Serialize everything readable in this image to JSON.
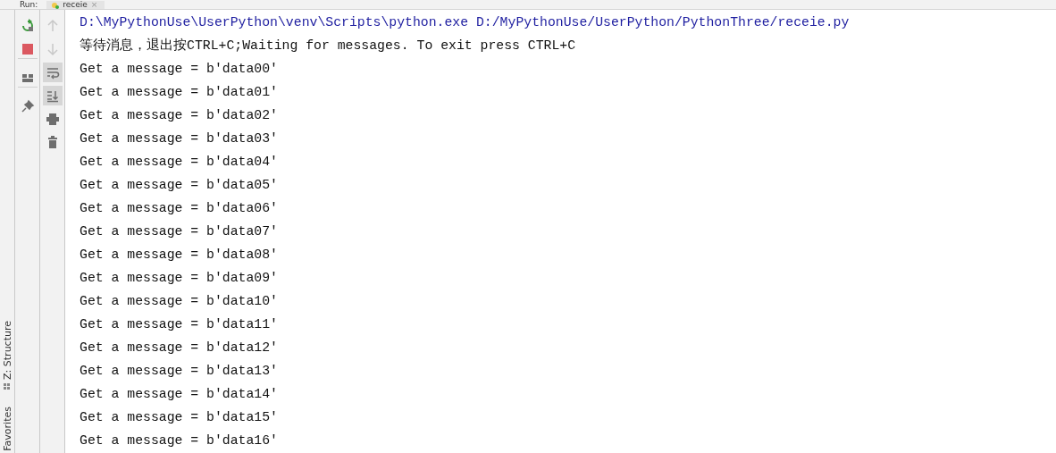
{
  "run_tabs": {
    "label": "Run:",
    "tabs": [
      {
        "label": "receie",
        "selected": true,
        "close": "×"
      }
    ]
  },
  "side_tabs": [
    {
      "label": "Z: Structure",
      "kind": "structure"
    },
    {
      "label": "Favorites",
      "kind": "plain"
    }
  ],
  "toolbar_primary": [
    {
      "kind": "rerun"
    },
    {
      "kind": "stop"
    },
    {
      "kind": "layout"
    },
    {
      "kind": "pin"
    }
  ],
  "toolbar_secondary": [
    {
      "kind": "up",
      "selected": false,
      "disabled": true
    },
    {
      "kind": "down",
      "selected": false,
      "disabled": true
    },
    {
      "kind": "wrap",
      "selected": true,
      "disabled": false
    },
    {
      "kind": "scroll-end",
      "selected": true,
      "disabled": false
    },
    {
      "kind": "print",
      "selected": false,
      "disabled": false
    },
    {
      "kind": "trash",
      "selected": false,
      "disabled": false
    }
  ],
  "console_lines": [
    {
      "kind": "command",
      "text": "D:\\MyPythonUse\\UserPython\\venv\\Scripts\\python.exe D:/MyPythonUse/UserPython/PythonThree/receie.py"
    },
    {
      "kind": "output",
      "text": "等待消息，退出按CTRL+C;Waiting for messages. To exit press CTRL+C"
    },
    {
      "kind": "output",
      "text": "Get a message = b'data00'"
    },
    {
      "kind": "output",
      "text": "Get a message = b'data01'"
    },
    {
      "kind": "output",
      "text": "Get a message = b'data02'"
    },
    {
      "kind": "output",
      "text": "Get a message = b'data03'"
    },
    {
      "kind": "output",
      "text": "Get a message = b'data04'"
    },
    {
      "kind": "output",
      "text": "Get a message = b'data05'"
    },
    {
      "kind": "output",
      "text": "Get a message = b'data06'"
    },
    {
      "kind": "output",
      "text": "Get a message = b'data07'"
    },
    {
      "kind": "output",
      "text": "Get a message = b'data08'"
    },
    {
      "kind": "output",
      "text": "Get a message = b'data09'"
    },
    {
      "kind": "output",
      "text": "Get a message = b'data10'"
    },
    {
      "kind": "output",
      "text": "Get a message = b'data11'"
    },
    {
      "kind": "output",
      "text": "Get a message = b'data12'"
    },
    {
      "kind": "output",
      "text": "Get a message = b'data13'"
    },
    {
      "kind": "output",
      "text": "Get a message = b'data14'"
    },
    {
      "kind": "output",
      "text": "Get a message = b'data15'"
    },
    {
      "kind": "output",
      "text": "Get a message = b'data16'"
    }
  ]
}
